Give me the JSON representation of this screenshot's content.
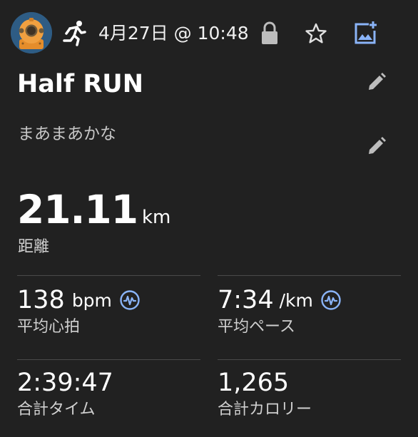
{
  "header": {
    "avatar_icon": "diving-helmet-avatar",
    "activity_icon": "running-person-icon",
    "date_time": "4月27日 @ 10:48",
    "privacy_icon": "lock-icon",
    "favorite_icon": "star-outline-icon",
    "add_photo_icon": "add-photo-icon"
  },
  "activity": {
    "title": "Half RUN",
    "note": "まあまあかな",
    "edit_icon": "pencil-icon"
  },
  "distance": {
    "value": "21.11",
    "unit": "km",
    "label": "距離"
  },
  "stats": {
    "heart_rate": {
      "value": "138",
      "unit": "bpm",
      "label": "平均心拍",
      "icon": "heart-rate-chart-icon"
    },
    "pace": {
      "value": "7:34",
      "unit": "/km",
      "label": "平均ペース",
      "icon": "pace-chart-icon"
    },
    "total_time": {
      "value": "2:39:47",
      "label": "合計タイム"
    },
    "calories": {
      "value": "1,265",
      "label": "合計カロリー"
    }
  },
  "colors": {
    "background": "#212121",
    "accent_blue": "#8ab4f8",
    "icon_gray": "#bdbdbd",
    "divider": "#4a4a4a",
    "avatar_bg": "#2e5c84",
    "helmet_orange": "#f0a040"
  }
}
